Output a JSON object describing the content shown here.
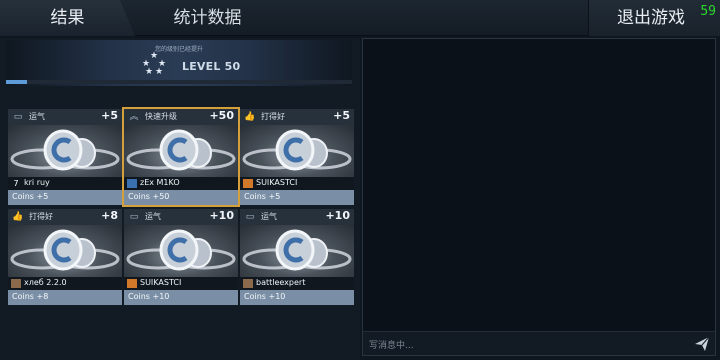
{
  "tabs": {
    "results": "结果",
    "stats": "统计数据"
  },
  "exit": {
    "label": "退出游戏",
    "fps": "59"
  },
  "level": {
    "note": "您的级别已经提升",
    "label": "LEVEL 50",
    "progress": 0.06
  },
  "cards": [
    {
      "icon": "wallet-icon",
      "category": "运气",
      "points": "+5",
      "player_icon": "rank-7-icon",
      "player_icon_text": "7",
      "player": "kri ruy",
      "reward": "Coins +5",
      "selected": false
    },
    {
      "icon": "chevron-up-icon",
      "category": "快速升级",
      "points": "+50",
      "player_icon": "clan-badge-icon",
      "player_icon_text": "",
      "player": "zEx M1KO",
      "reward": "Coins +50",
      "selected": true
    },
    {
      "icon": "thumbs-up-icon",
      "category": "打得好",
      "points": "+5",
      "player_icon": "wings-badge-icon",
      "player_icon_text": "",
      "player": "SUIKASTCI",
      "reward": "Coins +5",
      "selected": false
    },
    {
      "icon": "thumbs-up-icon",
      "category": "打得好",
      "points": "+8",
      "player_icon": "avatar-icon",
      "player_icon_text": "",
      "player": "хлеб 2.2.0",
      "reward": "Coins +8",
      "selected": false
    },
    {
      "icon": "wallet-icon",
      "category": "运气",
      "points": "+10",
      "player_icon": "wings-badge-icon",
      "player_icon_text": "",
      "player": "SUIKASTCI",
      "reward": "Coins +10",
      "selected": false
    },
    {
      "icon": "wallet-icon",
      "category": "运气",
      "points": "+10",
      "player_icon": "avatar-icon",
      "player_icon_text": "",
      "player": "battleexpert",
      "reward": "Coins +10",
      "selected": false
    }
  ],
  "chat": {
    "placeholder": "写消息中..."
  },
  "colors": {
    "accent": "#d4a03b",
    "reward_bg": "#7a8fa6",
    "xp": "#5f9bd8",
    "fps": "#2bd82b"
  }
}
